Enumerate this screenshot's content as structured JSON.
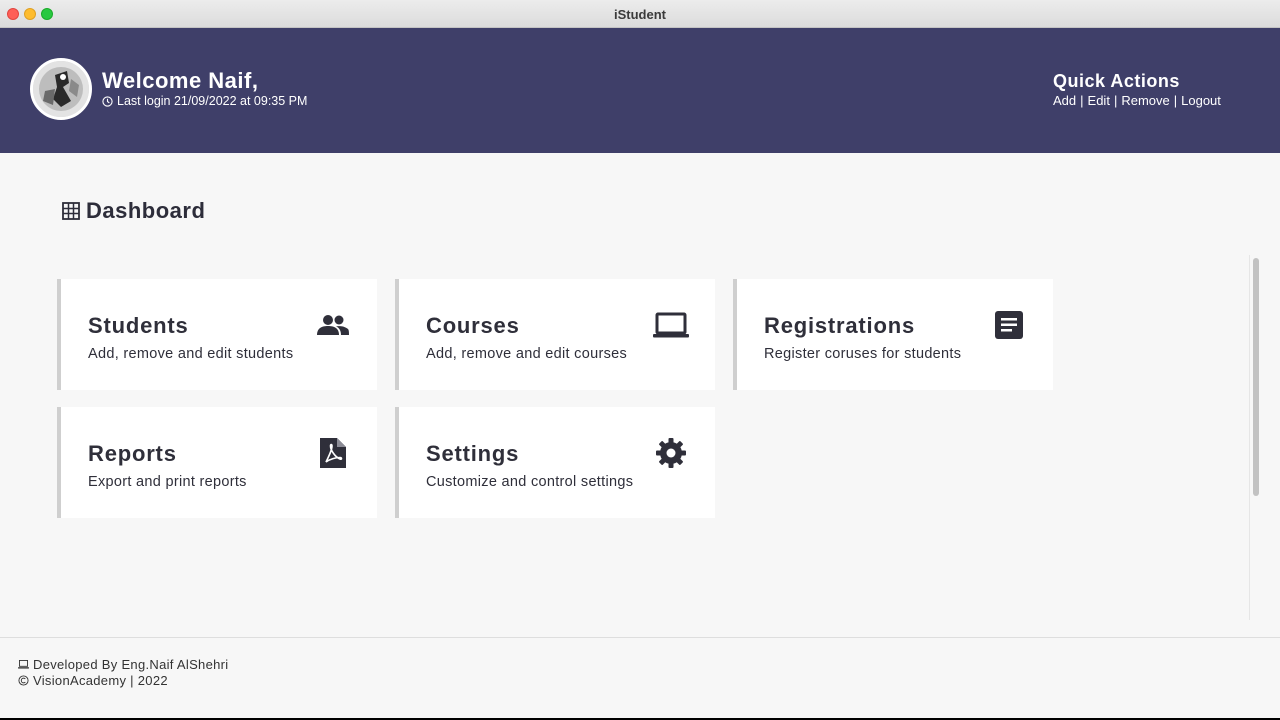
{
  "window": {
    "title": "iStudent"
  },
  "header": {
    "welcome": "Welcome Naif,",
    "last_login": "Last login 21/09/2022 at 09:35 PM",
    "quick_actions": {
      "title": "Quick Actions",
      "links": [
        "Add",
        "Edit",
        "Remove",
        "Logout"
      ],
      "separator": "|"
    },
    "bg_color": "#3f3f69"
  },
  "dashboard": {
    "title": "Dashboard",
    "cards": [
      {
        "title": "Students",
        "desc": "Add, remove and edit students",
        "icon": "users-icon"
      },
      {
        "title": "Courses",
        "desc": "Add, remove and edit courses",
        "icon": "laptop-icon"
      },
      {
        "title": "Registrations",
        "desc": "Register coruses for students",
        "icon": "document-icon"
      },
      {
        "title": "Reports",
        "desc": "Export and print reports",
        "icon": "pdf-icon"
      },
      {
        "title": "Settings",
        "desc": "Customize and control settings",
        "icon": "gear-icon"
      }
    ]
  },
  "footer": {
    "developer": "Developed By Eng.Naif AlShehri",
    "copyright": "VisionAcademy | 2022"
  }
}
